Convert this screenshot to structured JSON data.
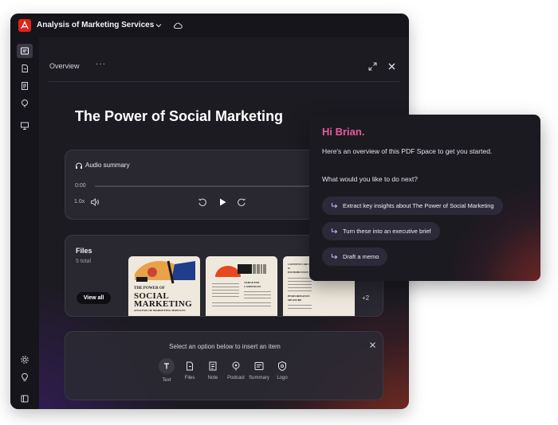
{
  "window": {
    "title": "Analysis of Marketing Services"
  },
  "main": {
    "tab_label": "Overview",
    "more_label": "···",
    "page_title": "The Power of Social Marketing"
  },
  "audio": {
    "label": "Audio summary",
    "time": "0:00",
    "speed": "1.0x",
    "progress": 0
  },
  "files": {
    "title": "Files",
    "count": "5 total",
    "view_all": "View all",
    "more": "+2",
    "thumb1": {
      "line1": "THE POWER OF",
      "line2": "SOCIAL",
      "line3": "MARKETING",
      "line4": "ANALYSIS OF MARKETING SERVICES"
    },
    "thumb2": {
      "line1": "TARGETED",
      "line2": "CAMPAIGNS"
    },
    "thumb3": {
      "line1": "CONTENT CREATION",
      "line2": "&",
      "line3": "DISTRIBUTION",
      "line4": "PERFORMANCE",
      "line5": "MEASURE"
    }
  },
  "insert": {
    "prompt": "Select an option below to insert an item",
    "items": [
      {
        "label": "Text",
        "icon": "text-icon"
      },
      {
        "label": "Files",
        "icon": "files-icon"
      },
      {
        "label": "Note",
        "icon": "note-icon"
      },
      {
        "label": "Podcast",
        "icon": "podcast-icon"
      },
      {
        "label": "Summary",
        "icon": "summary-icon"
      },
      {
        "label": "Logo",
        "icon": "logo-icon"
      }
    ]
  },
  "assistant": {
    "greeting": "Hi Brian.",
    "intro": "Here's an overview of this PDF Space to get you started.",
    "question": "What would you like to do next?",
    "suggestions": [
      "Extract key insights about The Power of Social Marketing",
      "Turn these into an executive brief",
      "Draft a memo"
    ]
  },
  "colors": {
    "brand_red": "#e0231b",
    "greeting_pink": "#e65a9e",
    "panel_bg": "#1d1b22"
  }
}
